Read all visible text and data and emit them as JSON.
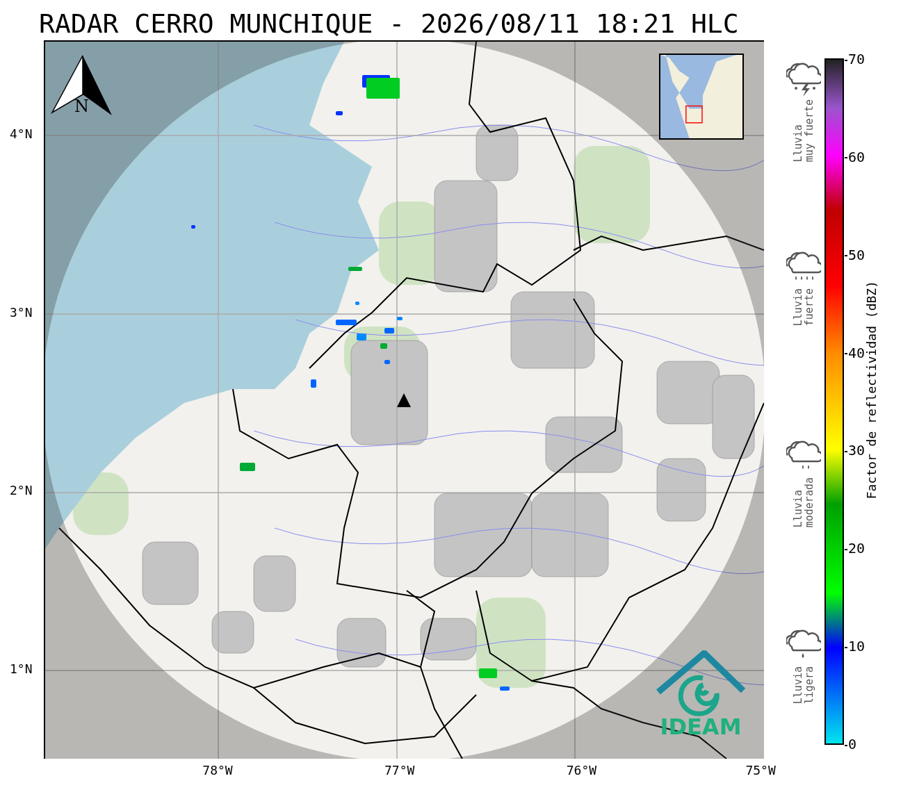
{
  "title": "RADAR CERRO MUNCHIQUE - 2026/08/11 18:21 HLC",
  "map": {
    "north_label": "N",
    "lat_ticks": [
      "4°N",
      "3°N",
      "2°N",
      "1°N"
    ],
    "lon_ticks": [
      "78°W",
      "77°W",
      "76°W",
      "75°W"
    ],
    "logo_text": "IDEAM"
  },
  "legend": [
    {
      "kind": "storm",
      "label": "Lluvia\nmuy fuerte"
    },
    {
      "kind": "heavy_rain",
      "label": "Lluvia\nfuerte"
    },
    {
      "kind": "rain",
      "label": "Lluvia\nmoderada"
    },
    {
      "kind": "light_rain",
      "label": "Lluvia\nligera"
    }
  ],
  "colorbar": {
    "label": "Factor de reflectividad (dBZ)",
    "ticks": [
      "70",
      "60",
      "50",
      "40",
      "30",
      "20",
      "10",
      "0"
    ]
  }
}
